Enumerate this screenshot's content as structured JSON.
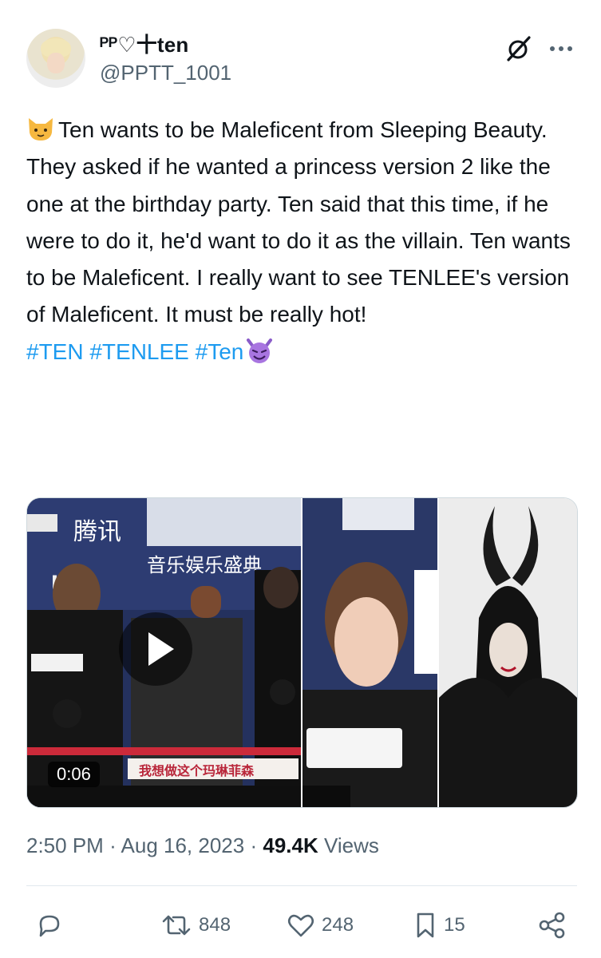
{
  "author": {
    "display_name": "ᴾᴾ♡十ten",
    "handle": "@PPTT_1001"
  },
  "tweet": {
    "emoji_lead": "cat-face",
    "text": "Ten wants to be Maleficent from Sleeping Beauty. They asked if he wanted a princess version 2 like the one at the birthday party. Ten said that this time, if he were to do it, he'd want to do it as the villain. Ten wants to be Maleficent. I really want to see TENLEE's version of Maleficent. It must be really hot!",
    "hashtags": "#TEN #TENLEE #Ten",
    "emoji_trail": "smiling-imp"
  },
  "media": {
    "video_duration": "0:06",
    "video_subtitle": "我想做这个玛琳菲森"
  },
  "meta": {
    "time": "2:50 PM",
    "separator": "·",
    "date": "Aug 16, 2023",
    "views_count": "49.4K",
    "views_label": "Views"
  },
  "actions": {
    "replies": "",
    "reposts": "848",
    "likes": "248",
    "bookmarks": "15"
  },
  "icons": [
    "grok-icon",
    "more-icon",
    "reply-icon",
    "repost-icon",
    "like-icon",
    "bookmark-icon",
    "share-icon",
    "play-icon"
  ],
  "colors": {
    "text": "#0f1419",
    "secondary": "#536471",
    "link": "#1d9bf0",
    "border": "#cfd9de"
  }
}
